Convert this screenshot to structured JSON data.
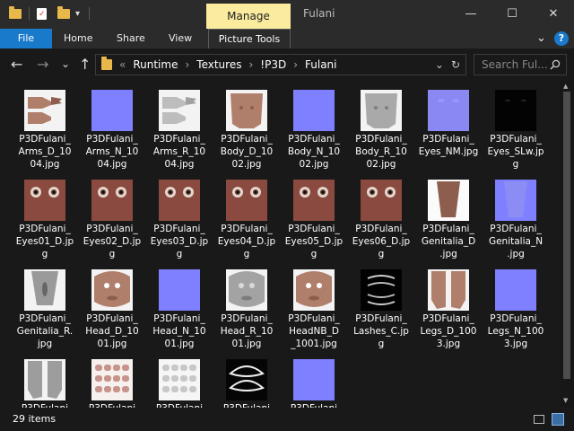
{
  "window": {
    "title": "Fulani",
    "context_tab": "Manage",
    "controls": [
      "—",
      "☐",
      "✕"
    ]
  },
  "ribbon": {
    "file_label": "File",
    "tabs": [
      "Home",
      "Share",
      "View"
    ],
    "context_tab": "Picture Tools",
    "chevron": "⌄",
    "help": "?"
  },
  "address": {
    "prefix": "«",
    "crumbs": [
      "Runtime",
      "Textures",
      "!P3D",
      "Fulani"
    ],
    "separator": "›",
    "refresh": "↻",
    "dropdown": "⌄"
  },
  "search": {
    "placeholder": "Search Ful..."
  },
  "nav": {
    "back": "←",
    "forward": "→",
    "recent": "⌄",
    "up": "↑"
  },
  "files": [
    {
      "name": "P3DFulani_Arms_D_1004.jpg",
      "lines": [
        "P3DFulani_",
        "Arms_D_10",
        "04.jpg"
      ],
      "kind": "arms_d"
    },
    {
      "name": "P3DFulani_Arms_N_1004.jpg",
      "lines": [
        "P3DFulani_",
        "Arms_N_10",
        "04.jpg"
      ],
      "kind": "normal"
    },
    {
      "name": "P3DFulani_Arms_R_1004.jpg",
      "lines": [
        "P3DFulani_",
        "Arms_R_10",
        "04.jpg"
      ],
      "kind": "arms_r"
    },
    {
      "name": "P3DFulani_Body_D_1002.jpg",
      "lines": [
        "P3DFulani_",
        "Body_D_10",
        "02.jpg"
      ],
      "kind": "body_d"
    },
    {
      "name": "P3DFulani_Body_N_1002.jpg",
      "lines": [
        "P3DFulani_",
        "Body_N_10",
        "02.jpg"
      ],
      "kind": "normal"
    },
    {
      "name": "P3DFulani_Body_R_1002.jpg",
      "lines": [
        "P3DFulani_",
        "Body_R_10",
        "02.jpg"
      ],
      "kind": "body_r"
    },
    {
      "name": "P3DFulani_Eyes_NM.jpg",
      "lines": [
        "P3DFulani_",
        "Eyes_NM.jpg"
      ],
      "kind": "normal_light"
    },
    {
      "name": "P3DFulani_Eyes_SLw.jpg",
      "lines": [
        "P3DFulani_",
        "Eyes_SLw.jp",
        "g"
      ],
      "kind": "black"
    },
    {
      "name": "P3DFulani_Eyes01_D.jpg",
      "lines": [
        "P3DFulani_",
        "Eyes01_D.jp",
        "g"
      ],
      "kind": "eyes"
    },
    {
      "name": "P3DFulani_Eyes02_D.jpg",
      "lines": [
        "P3DFulani_",
        "Eyes02_D.jp",
        "g"
      ],
      "kind": "eyes"
    },
    {
      "name": "P3DFulani_Eyes03_D.jpg",
      "lines": [
        "P3DFulani_",
        "Eyes03_D.jp",
        "g"
      ],
      "kind": "eyes"
    },
    {
      "name": "P3DFulani_Eyes04_D.jpg",
      "lines": [
        "P3DFulani_",
        "Eyes04_D.jp",
        "g"
      ],
      "kind": "eyes"
    },
    {
      "name": "P3DFulani_Eyes05_D.jpg",
      "lines": [
        "P3DFulani_",
        "Eyes05_D.jp",
        "g"
      ],
      "kind": "eyes"
    },
    {
      "name": "P3DFulani_Eyes06_D.jpg",
      "lines": [
        "P3DFulani_",
        "Eyes06_D.jp",
        "g"
      ],
      "kind": "eyes"
    },
    {
      "name": "P3DFulani_Genitalia_D.jpg",
      "lines": [
        "P3DFulani_",
        "Genitalia_D",
        ".jpg"
      ],
      "kind": "gen_d"
    },
    {
      "name": "P3DFulani_Genitalia_N.jpg",
      "lines": [
        "P3DFulani_",
        "Genitalia_N",
        ".jpg"
      ],
      "kind": "gen_n"
    },
    {
      "name": "P3DFulani_Genitalia_R.jpg",
      "lines": [
        "P3DFulani_",
        "Genitalia_R.",
        "jpg"
      ],
      "kind": "gen_r"
    },
    {
      "name": "P3DFulani_Head_D_1001.jpg",
      "lines": [
        "P3DFulani_",
        "Head_D_10",
        "01.jpg"
      ],
      "kind": "head_d"
    },
    {
      "name": "P3DFulani_Head_N_1001.jpg",
      "lines": [
        "P3DFulani_",
        "Head_N_10",
        "01.jpg"
      ],
      "kind": "normal"
    },
    {
      "name": "P3DFulani_Head_R_1001.jpg",
      "lines": [
        "P3DFulani_",
        "Head_R_10",
        "01.jpg"
      ],
      "kind": "head_r"
    },
    {
      "name": "P3DFulani_HeadNB_D_1001.jpg",
      "lines": [
        "P3DFulani_",
        "HeadNB_D",
        "_1001.jpg"
      ],
      "kind": "head_d"
    },
    {
      "name": "P3DFulani_Lashes_C.jpg",
      "lines": [
        "P3DFulani_",
        "Lashes_C.jp",
        "g"
      ],
      "kind": "lashes"
    },
    {
      "name": "P3DFulani_Legs_D_1003.jpg",
      "lines": [
        "P3DFulani_",
        "Legs_D_100",
        "3.jpg"
      ],
      "kind": "legs_d"
    },
    {
      "name": "P3DFulani_Legs_N_1003.jpg",
      "lines": [
        "P3DFulani_",
        "Legs_N_100",
        "3.jpg"
      ],
      "kind": "normal"
    },
    {
      "name": "P3DFulani",
      "lines": [
        "P3DFulani"
      ],
      "kind": "legs_r"
    },
    {
      "name": "P3DFulani",
      "lines": [
        "P3DFulani"
      ],
      "kind": "teeth_d"
    },
    {
      "name": "P3DFulani",
      "lines": [
        "P3DFulani"
      ],
      "kind": "teeth_r"
    },
    {
      "name": "P3DFulani",
      "lines": [
        "P3DFulani"
      ],
      "kind": "mouth"
    },
    {
      "name": "P3DFulani",
      "lines": [
        "P3DFulani"
      ],
      "kind": "normal"
    }
  ],
  "status": {
    "count_text": "29 items"
  },
  "colors": {
    "accent": "#1979ca",
    "manage": "#fbeb9e",
    "normal_map": "#7f80ff"
  }
}
